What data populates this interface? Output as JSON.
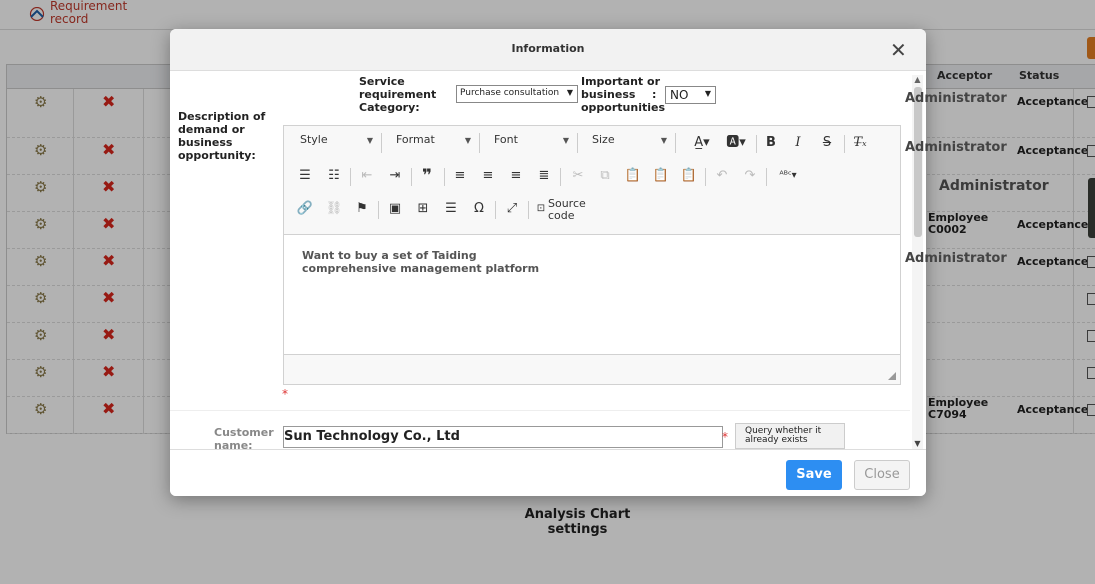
{
  "topbar": {
    "title": "Requirement record"
  },
  "grid": {
    "headers": {
      "acceptor": "Acceptor",
      "status": "Status"
    },
    "rows": [
      {
        "acceptor": "Administrator",
        "status": "Acceptance"
      },
      {
        "acceptor": "Administrator",
        "status": "Acceptance"
      },
      {
        "acceptor": "Administrator",
        "status": ""
      },
      {
        "acceptor": "Employee C0002",
        "status": "Acceptance"
      },
      {
        "acceptor": "Administrator",
        "status": "Acceptance"
      },
      {
        "acceptor": "",
        "status": ""
      },
      {
        "acceptor": "",
        "status": ""
      },
      {
        "acceptor": "",
        "status": ""
      },
      {
        "acceptor": "Employee C7094",
        "status": "Acceptance"
      }
    ]
  },
  "analysis": {
    "label": "Analysis Chart settings"
  },
  "dialog": {
    "title": "Information",
    "category_label": "Service requirement Category:",
    "category_value": "Purchase consultation",
    "important_label": "Important or business opportunities",
    "important_colon": ":",
    "important_value": "NO",
    "description_label": "Description of demand or business opportunity:",
    "editor": {
      "combos": [
        "Style",
        "Format",
        "Font",
        "Size"
      ],
      "source_code": "Source code",
      "content": "Want to buy a set of Taiding comprehensive management platform"
    },
    "customer_label": "Customer name:",
    "customer_value": "Sun Technology Co., Ltd",
    "query_button": "Query whether it already exists",
    "required_mark": "*",
    "save_label": "Save",
    "close_label": "Close"
  },
  "colors": {
    "primary": "#2d8ef2",
    "danger": "#d9261c",
    "brand": "#c0392b"
  },
  "icons": [
    "gear-icon",
    "delete-x-icon",
    "close-icon",
    "bold-icon",
    "italic-icon",
    "strike-icon",
    "link-icon",
    "image-icon",
    "table-icon",
    "omega-icon",
    "maximize-icon"
  ]
}
